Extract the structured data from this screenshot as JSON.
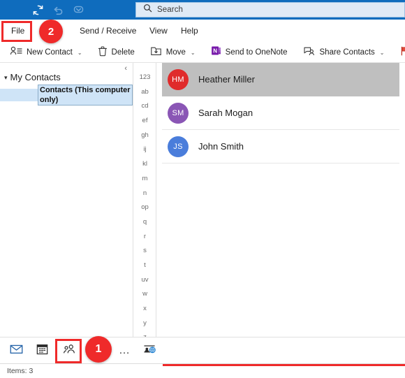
{
  "titlebar": {
    "quick_access": [
      {
        "name": "refresh-icon",
        "label": "Refresh"
      },
      {
        "name": "undo-icon",
        "label": "Undo"
      },
      {
        "name": "customize-quick-access-icon",
        "label": "Customize Quick Access Toolbar"
      }
    ]
  },
  "search": {
    "placeholder": "Search",
    "icon": "search-icon"
  },
  "tabs": [
    {
      "id": "file",
      "label": "File"
    },
    {
      "id": "sendreceive",
      "label": "Send / Receive"
    },
    {
      "id": "view",
      "label": "View"
    },
    {
      "id": "help",
      "label": "Help"
    }
  ],
  "toolbar": {
    "new_contact_label": "New Contact",
    "delete_label": "Delete",
    "move_label": "Move",
    "onenote_label": "Send to OneNote",
    "share_contacts_label": "Share Contacts",
    "caret": "⌄",
    "icons": {
      "new_contact": "new-contact-icon",
      "delete": "trash-icon",
      "move": "move-folder-icon",
      "onenote": "onenote-icon",
      "share": "share-contacts-icon",
      "flag": "flag-icon"
    }
  },
  "folder_pane": {
    "collapse_icon": "chevron-left-icon",
    "group_chevron": "chevron-down-icon",
    "group_label": "My Contacts",
    "selected_folder": "Contacts (This computer only)"
  },
  "alpha_index": [
    "123",
    "ab",
    "cd",
    "ef",
    "gh",
    "ij",
    "kl",
    "m",
    "n",
    "op",
    "q",
    "r",
    "s",
    "t",
    "uv",
    "w",
    "x",
    "y",
    "z"
  ],
  "contacts": [
    {
      "name": "Heather Miller",
      "initials": "HM",
      "color": "#e02b2b",
      "selected": true
    },
    {
      "name": "Sarah Mogan",
      "initials": "SM",
      "color": "#8a56b5",
      "selected": false
    },
    {
      "name": "John Smith",
      "initials": "JS",
      "color": "#4a7ddb",
      "selected": false
    }
  ],
  "bottom_nav": [
    {
      "id": "mail",
      "icon": "mail-icon",
      "label": "Mail"
    },
    {
      "id": "calendar",
      "icon": "calendar-icon",
      "label": "Calendar"
    },
    {
      "id": "people",
      "icon": "people-icon",
      "label": "People"
    },
    {
      "id": "more",
      "icon": "ellipsis-icon",
      "label": "More"
    },
    {
      "id": "reading",
      "icon": "reading-pane-icon",
      "label": "Reading Pane"
    }
  ],
  "status": {
    "items_text": "Items: 3"
  },
  "annotations": [
    {
      "id": "step-1",
      "number": "1",
      "target": "people-nav-button"
    },
    {
      "id": "step-2",
      "number": "2",
      "target": "file-tab"
    }
  ],
  "colors": {
    "titlebar_blue": "#0f6cbd",
    "accent_red": "#ef2a2a",
    "selection_gray": "#bfbfbf",
    "folder_selection_blue": "#cfe4f7"
  }
}
